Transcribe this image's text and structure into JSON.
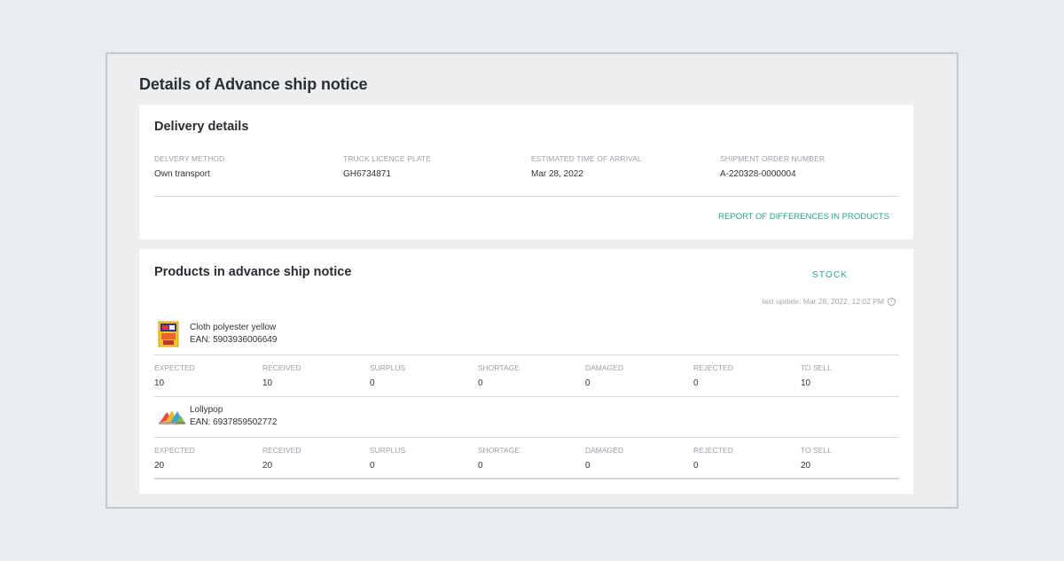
{
  "page": {
    "title": "Details of Advance ship notice"
  },
  "delivery": {
    "title": "Delivery details",
    "fields": [
      {
        "label": "DELVERY METHOD",
        "value": "Own transport"
      },
      {
        "label": "TRUCK LICENCE PLATE",
        "value": "GH6734871"
      },
      {
        "label": "ESTIMATED TIME OF ARRIVAL",
        "value": "Mar 28, 2022"
      },
      {
        "label": "SHIPMENT ORDER NUMBER",
        "value": "A-220328-0000004"
      }
    ],
    "report_link": "REPORT OF DIFFERENCES IN PRODUCTS"
  },
  "products": {
    "title": "Products in advance ship notice",
    "stock_button": "STOCK",
    "last_update": "last update: Mar 28, 2022, 12:02 PM",
    "info_icon_glyph": "i",
    "stat_labels": [
      "EXPECTED",
      "RECEIVED",
      "SURPLUS",
      "SHORTAGE",
      "DAMAGED",
      "REJECTED",
      "TO SELL"
    ],
    "items": [
      {
        "name": "Cloth polyester yellow",
        "ean": "EAN:  5903936006649",
        "icon": "cloth-package-icon",
        "stats": [
          "10",
          "10",
          "0",
          "0",
          "0",
          "0",
          "10"
        ]
      },
      {
        "name": "Lollypop",
        "ean": "EAN:  6937859502772",
        "icon": "lollypop-icon",
        "stats": [
          "20",
          "20",
          "0",
          "0",
          "0",
          "0",
          "20"
        ]
      }
    ]
  },
  "colors": {
    "accent": "#27a38b",
    "background": "#eaedf0",
    "card": "#ffffff",
    "label": "#99a1a8"
  }
}
